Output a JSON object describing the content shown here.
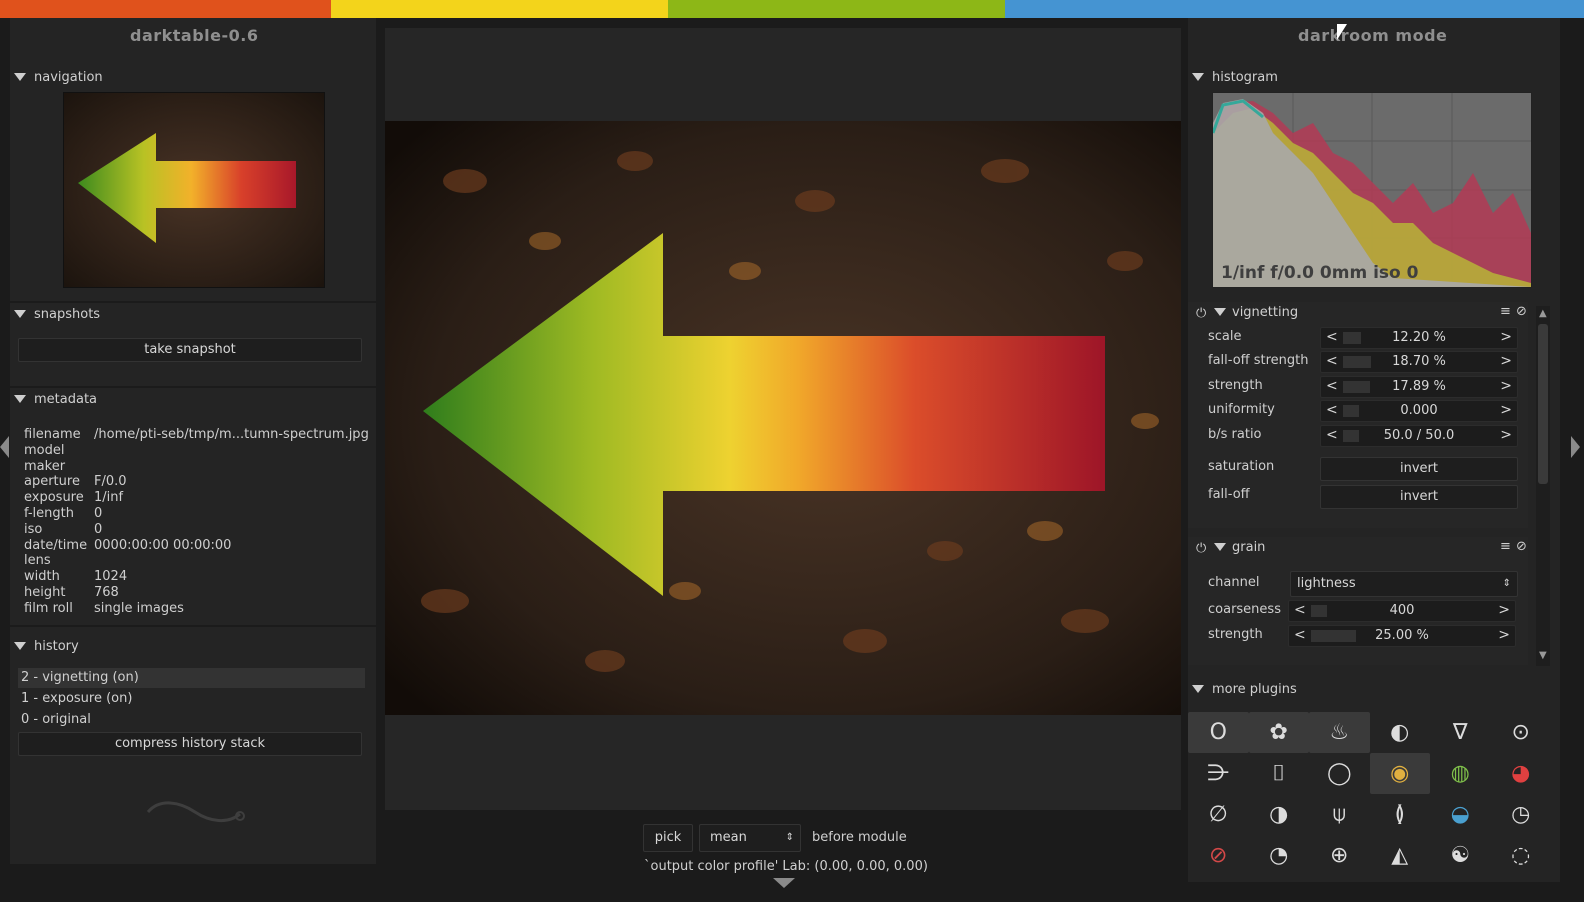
{
  "topbar_colors": [
    "#e0521c",
    "#f3d41b",
    "#8db717",
    "#4594d2"
  ],
  "left": {
    "title": "darktable-0.6",
    "navigation_label": "navigation",
    "snapshots_label": "snapshots",
    "take_snapshot": "take snapshot",
    "metadata_label": "metadata",
    "metadata": [
      {
        "k": "filename",
        "v": "/home/pti-seb/tmp/m...tumn-spectrum.jpg"
      },
      {
        "k": "model",
        "v": ""
      },
      {
        "k": "maker",
        "v": ""
      },
      {
        "k": "aperture",
        "v": "F/0.0"
      },
      {
        "k": "exposure",
        "v": "1/inf"
      },
      {
        "k": "f-length",
        "v": "0"
      },
      {
        "k": "iso",
        "v": "0"
      },
      {
        "k": "date/time",
        "v": "0000:00:00 00:00:00"
      },
      {
        "k": "lens",
        "v": ""
      },
      {
        "k": "width",
        "v": "1024"
      },
      {
        "k": "height",
        "v": "768"
      },
      {
        "k": "film roll",
        "v": "single images"
      }
    ],
    "history_label": "history",
    "history": [
      "2 - vignetting (on)",
      "1 - exposure (on)",
      "0 - original"
    ],
    "compress": "compress history stack"
  },
  "right": {
    "title": "darkroom mode",
    "histogram_label": "histogram",
    "histogram_info": "1/inf f/0.0 0mm iso 0",
    "vignetting": {
      "label": "vignetting",
      "sliders": [
        {
          "label": "scale",
          "value": "12.20 %",
          "level": 0.122
        },
        {
          "label": "fall-off strength",
          "value": "18.70 %",
          "level": 0.187
        },
        {
          "label": "strength",
          "value": "17.89 %",
          "level": 0.1789
        },
        {
          "label": "uniformity",
          "value": "0.000",
          "level": 0
        },
        {
          "label": "b/s ratio",
          "value": "50.0 / 50.0",
          "level": 0
        }
      ],
      "saturation_label": "saturation",
      "saturation_value": "invert",
      "falloff_label": "fall-off",
      "falloff_value": "invert"
    },
    "grain": {
      "label": "grain",
      "channel_label": "channel",
      "channel_value": "lightness",
      "coarseness_label": "coarseness",
      "coarseness_value": "400",
      "coarseness_level": 0.08,
      "strength_label": "strength",
      "strength_value": "25.00 %",
      "strength_level": 0.25
    },
    "more_plugins_label": "more plugins",
    "plugins": [
      "exposure-icon",
      "color-circles-icon",
      "temperature-icon",
      "spiral-icon",
      "filter-icon",
      "circle-dot-icon",
      "sharpen-icon",
      "crop-icon",
      "rotate-icon",
      "color-rainbow-icon",
      "color-wheel-icon",
      "color-balance-icon",
      "no-color-icon",
      "contrast-icon",
      "lowlight-icon",
      "pressure-icon",
      "equalizer-icon",
      "time-icon",
      "invert-icon",
      "monochrome-icon",
      "highlights-icon",
      "relight-icon",
      "grain-yinyang-icon",
      "shadows-icon"
    ]
  },
  "bottom": {
    "pick": "pick",
    "mode": "mean",
    "before": "before module",
    "status": "`output color profile' Lab: (0.00, 0.00, 0.00)"
  }
}
